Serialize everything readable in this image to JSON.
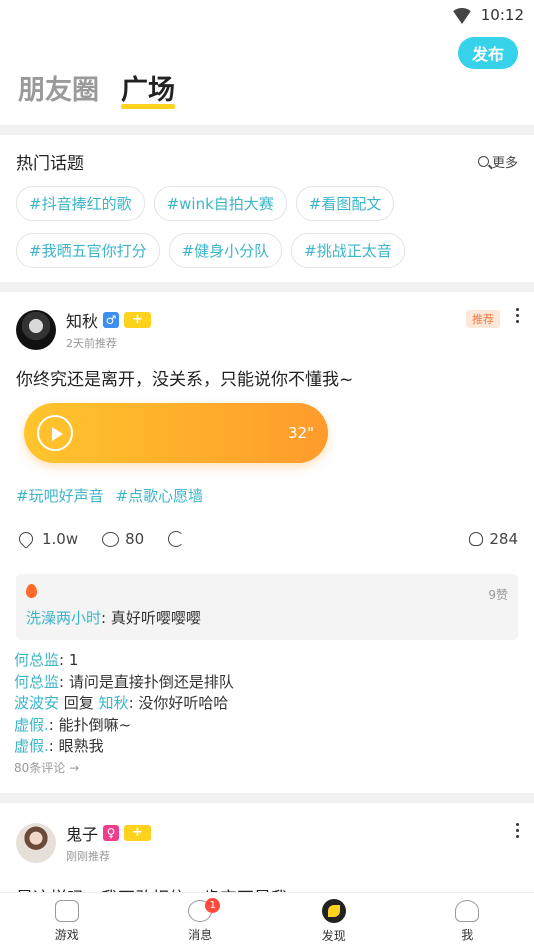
{
  "status": {
    "time": "10:12"
  },
  "header": {
    "publish": "发布",
    "tabs": [
      "朋友圈",
      "广场"
    ]
  },
  "topics": {
    "title": "热门话题",
    "more": "更多",
    "row1": [
      "#抖音捧红的歌",
      "#wink自拍大赛",
      "#看图配文"
    ],
    "row2": [
      "#我晒五官你打分",
      "#健身小分队",
      "#挑战正太音"
    ]
  },
  "post1": {
    "username": "知秋",
    "gender": "♂",
    "badge": "+",
    "time": "2天前推荐",
    "recommend": "推荐",
    "text": "你终究还是离开，没关系，只能说你不懂我~",
    "voice_duration": "32\"",
    "tags": [
      "#玩吧好声音",
      "#点歌心愿墙"
    ],
    "likes": "1.0w",
    "comments_count": "80",
    "flowers": "284",
    "hot_comment": {
      "likes": "9赞",
      "user": "洗澡两小时",
      "text": ": 真好听嘤嘤嘤"
    },
    "comments": [
      {
        "user": "何总监",
        "text": ": 1"
      },
      {
        "user": "何总监",
        "text": ": 请问是直接扑倒还是排队"
      },
      {
        "user": "波波安",
        "reply_word": " 回复 ",
        "reply_to": "知秋",
        "text": ": 没你好听哈哈"
      },
      {
        "user": "虚假.",
        "text": ": 能扑倒嘛~"
      },
      {
        "user": "虚假.",
        "text": ": 眼熟我"
      }
    ],
    "all_comments": "80条评论 →"
  },
  "post2": {
    "username": "鬼子",
    "gender": "♀",
    "badge": "+",
    "time": "刚刚推荐",
    "text": "是这样吗，我不敢相信，肯定不是我"
  },
  "nav": {
    "items": [
      "游戏",
      "消息",
      "发现",
      "我"
    ],
    "message_badge": "1"
  }
}
